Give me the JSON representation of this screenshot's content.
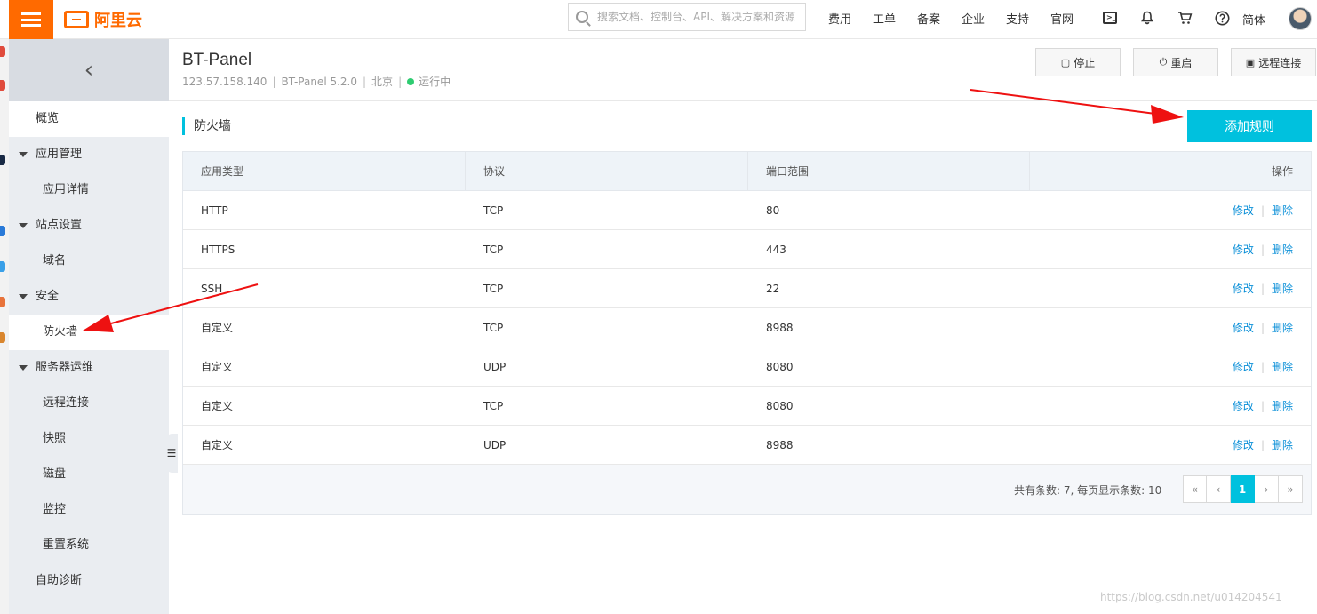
{
  "topbar": {
    "logo_text": "阿里云",
    "search_placeholder": "搜索文档、控制台、API、解决方案和资源",
    "nav": [
      "费用",
      "工单",
      "备案",
      "企业",
      "支持",
      "官网"
    ],
    "lang": "简体",
    "icons": [
      "terminal-icon",
      "bell-icon",
      "cart-icon",
      "help-icon"
    ]
  },
  "sidebar": {
    "back_icon": "chevron-left-icon",
    "items": [
      {
        "label": "概览",
        "type": "item"
      },
      {
        "label": "应用管理",
        "type": "group"
      },
      {
        "label": "应用详情",
        "type": "sub"
      },
      {
        "label": "站点设置",
        "type": "group"
      },
      {
        "label": "域名",
        "type": "sub"
      },
      {
        "label": "安全",
        "type": "group"
      },
      {
        "label": "防火墙",
        "type": "sub"
      },
      {
        "label": "服务器运维",
        "type": "group"
      },
      {
        "label": "远程连接",
        "type": "sub"
      },
      {
        "label": "快照",
        "type": "sub"
      },
      {
        "label": "磁盘",
        "type": "sub"
      },
      {
        "label": "监控",
        "type": "sub"
      },
      {
        "label": "重置系统",
        "type": "sub"
      },
      {
        "label": "自助诊断",
        "type": "item"
      }
    ]
  },
  "instance": {
    "title": "BT-Panel",
    "ip": "123.57.158.140",
    "image": "BT-Panel 5.2.0",
    "region": "北京",
    "status": "运行中"
  },
  "actions": {
    "stop": "停止",
    "restart": "重启",
    "remote": "远程连接"
  },
  "firewall": {
    "title": "防火墙",
    "add_rule": "添加规则",
    "columns": [
      "应用类型",
      "协议",
      "端口范围",
      "操作"
    ],
    "rows": [
      {
        "type": "HTTP",
        "protocol": "TCP",
        "port": "80"
      },
      {
        "type": "HTTPS",
        "protocol": "TCP",
        "port": "443"
      },
      {
        "type": "SSH",
        "protocol": "TCP",
        "port": "22"
      },
      {
        "type": "自定义",
        "protocol": "TCP",
        "port": "8988"
      },
      {
        "type": "自定义",
        "protocol": "UDP",
        "port": "8080"
      },
      {
        "type": "自定义",
        "protocol": "TCP",
        "port": "8080"
      },
      {
        "type": "自定义",
        "protocol": "UDP",
        "port": "8988"
      }
    ],
    "edit_label": "修改",
    "delete_label": "删除",
    "total_text": "共有条数: 7, 每页显示条数: 10",
    "pager": [
      "«",
      "‹",
      "1",
      "›",
      "»"
    ],
    "current_page": "1"
  },
  "watermark": "https://blog.csdn.net/u014204541",
  "colors": {
    "brand": "#ff6a00",
    "accent": "#00c1de",
    "link": "#0a8fd8",
    "status_running": "#2ecc71",
    "annotation_arrow": "#ee1111"
  }
}
